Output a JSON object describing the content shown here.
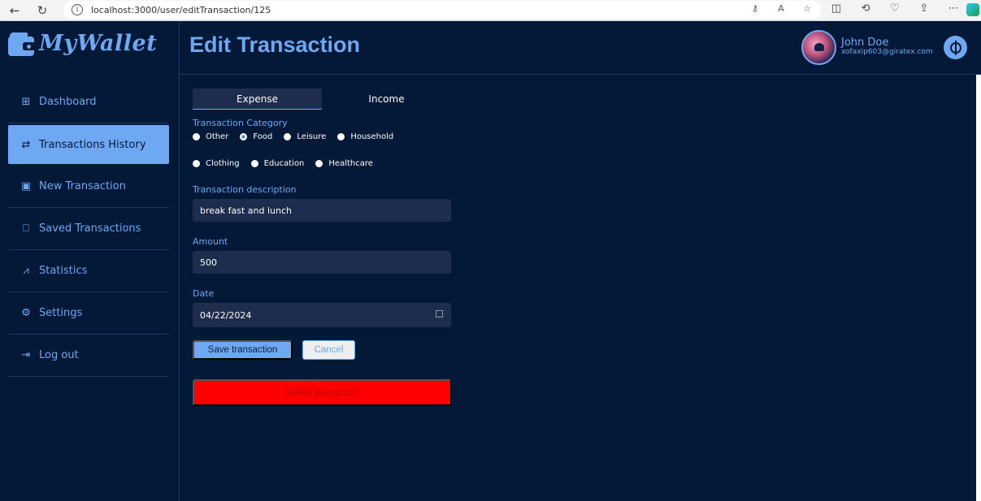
{
  "browser": {
    "url": "localhost:3000/user/editTransaction/125",
    "back_glyph": "←",
    "reload_glyph": "↻"
  },
  "brand": {
    "name": "MyWallet",
    "color": "#6ea8f2"
  },
  "sidebar": {
    "items": [
      {
        "label": "Dashboard",
        "icon": "grid-icon"
      },
      {
        "label": "Transactions History",
        "icon": "arrows-exchange-icon"
      },
      {
        "label": "New Transaction",
        "icon": "calendar-plus-icon"
      },
      {
        "label": "Saved Transactions",
        "icon": "bookmark-icon"
      },
      {
        "label": "Statistics",
        "icon": "chart-line-icon"
      },
      {
        "label": "Settings",
        "icon": "gear-icon"
      },
      {
        "label": "Log out",
        "icon": "logout-icon"
      }
    ],
    "active": "Transactions History"
  },
  "header": {
    "title": "Edit Transaction",
    "user_name": "John Doe",
    "user_email": "xofaxip603@giratex.com"
  },
  "form": {
    "tabs": [
      "Expense",
      "Income"
    ],
    "active_tab": "Expense",
    "category_label": "Transaction Category",
    "categories": [
      "Other",
      "Food",
      "Leisure",
      "Household",
      "Clothing",
      "Education",
      "Healthcare"
    ],
    "selected_category": "Food",
    "description_label": "Transaction description",
    "description_value": "break fast and lunch",
    "amount_label": "Amount",
    "amount_value": "500",
    "date_label": "Date",
    "date_value": "04/22/2024",
    "save_label": "Save transaction",
    "cancel_label": "Cancel",
    "delete_label": "Delete transaction"
  },
  "colors": {
    "background": "#031937",
    "accent": "#6ea8f2",
    "field_bg": "#1e2c4e",
    "danger": "#fe0000"
  }
}
